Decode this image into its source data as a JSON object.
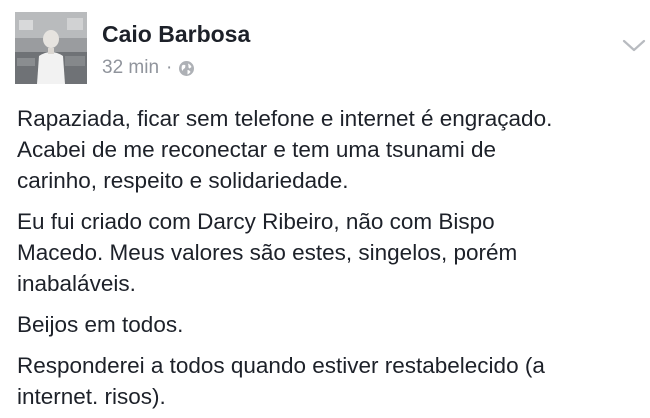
{
  "post": {
    "author": "Caio Barbosa",
    "timestamp": "32 min",
    "separator": "·",
    "privacy_icon": "globe-icon",
    "menu_icon": "chevron-down-icon",
    "paragraphs": [
      "Rapaziada, ficar sem telefone e internet é engraçado.\nAcabei de me reconectar e tem uma tsunami de\ncarinho, respeito e solidariedade.",
      "Eu fui criado com Darcy Ribeiro, não com Bispo\nMacedo. Meus valores são estes, singelos, porém\ninabaláveis.",
      "Beijos em todos.",
      "Responderei a todos quando estiver restabelecido (a\ninternet. risos)."
    ]
  }
}
